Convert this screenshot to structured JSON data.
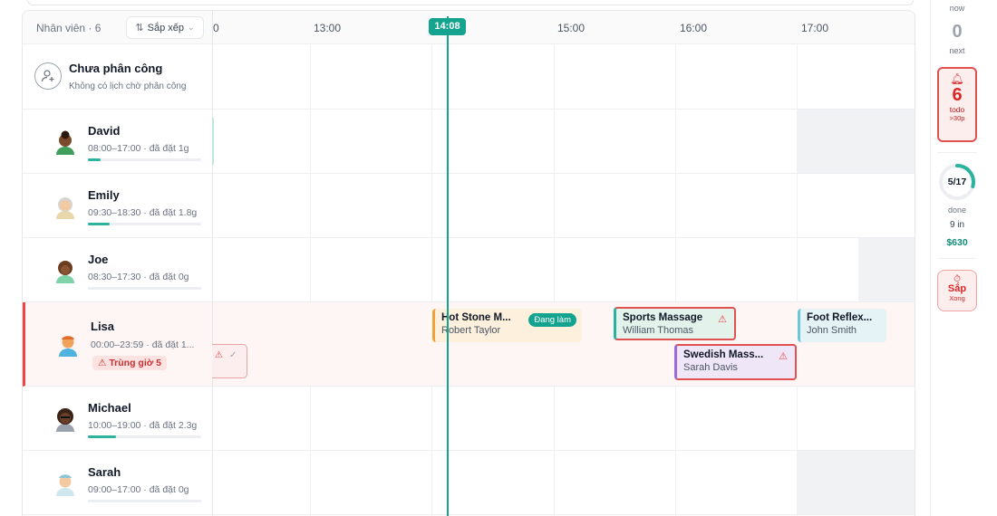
{
  "header": {
    "staff_title": "Nhân viên · 6",
    "sort_label": "Sắp xếp",
    "now_time": "14:08",
    "ticks": [
      "0",
      "13:00",
      "15:00",
      "16:00",
      "17:00"
    ]
  },
  "unassigned": {
    "title": "Chưa phân công",
    "subtitle": "Không có lịch chờ phân công"
  },
  "staff": [
    {
      "name": "David",
      "hours": "08:00–17:00 · đã đặt 1g",
      "booked_fraction": 0.11
    },
    {
      "name": "Emily",
      "hours": "09:30–18:30 · đã đặt 1.8g",
      "booked_fraction": 0.19
    },
    {
      "name": "Joe",
      "hours": "08:30–17:30 · đã đặt 0g",
      "booked_fraction": 0
    },
    {
      "name": "Lisa",
      "hours": "00:00–23:59 · đã đặt 1...",
      "overlap_badge": "Trùng giờ 5"
    },
    {
      "name": "Michael",
      "hours": "10:00–19:00 · đã đặt 2.3g",
      "booked_fraction": 0.25
    },
    {
      "name": "Sarah",
      "hours": "09:00–17:00 · đã đặt 0g",
      "booked_fraction": 0
    }
  ],
  "appointments": [
    {
      "service": "Hot Stone M...",
      "client": "Robert Taylor",
      "status": "Đang làm"
    },
    {
      "service": "Sports Massage",
      "client": "William Thomas"
    },
    {
      "service": "Foot Reflex...",
      "client": "John Smith"
    },
    {
      "service": "Swedish Mass...",
      "client": "Sarah Davis"
    }
  ],
  "summary": {
    "now_label": "now",
    "next_count": "0",
    "next_label": "next",
    "todo_count": "6",
    "todo_label": "todo",
    "todo_sub": ">30p",
    "done_ratio": "5/17",
    "done_fraction": 0.294,
    "done_label": "done",
    "in_label": "9 in",
    "revenue": "$630",
    "soon_label": "Sắp",
    "soon_sub": "Xong"
  },
  "colors": {
    "accent": "#14a38f",
    "warning": "#e05252"
  }
}
